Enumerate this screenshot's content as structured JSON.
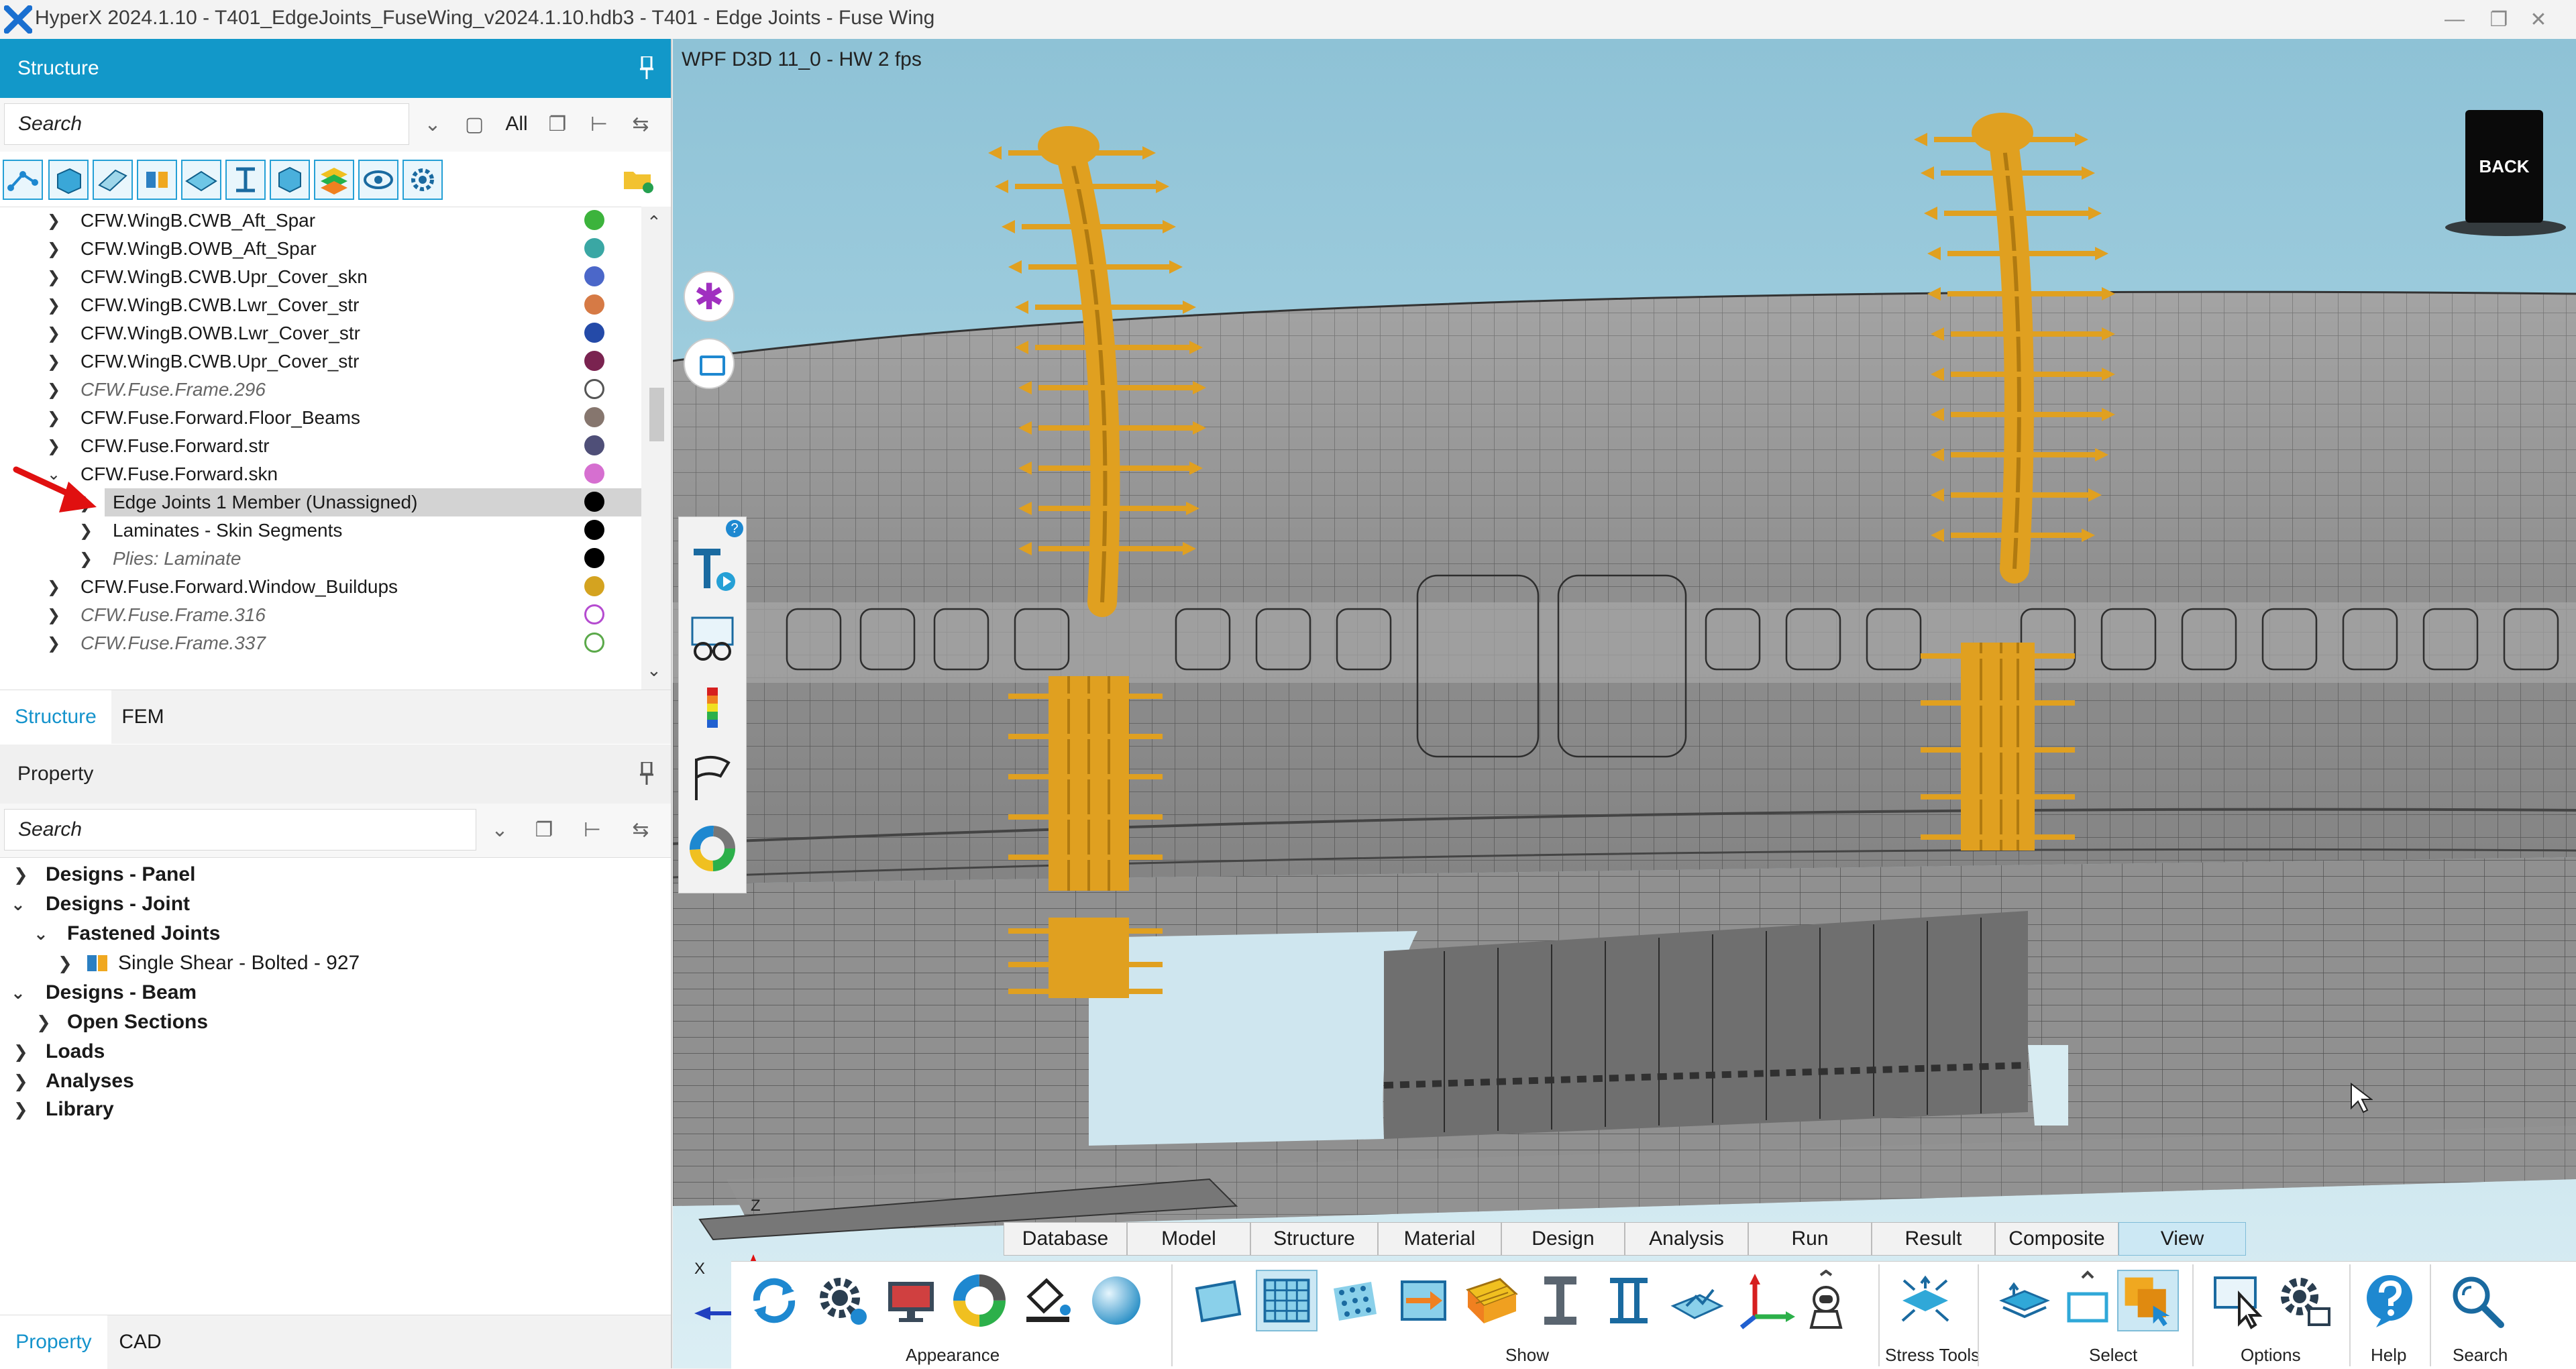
{
  "window": {
    "title": "HyperX 2024.1.10 - T401_EdgeJoints_FuseWing_v2024.1.10.hdb3 - T401 - Edge Joints - Fuse Wing"
  },
  "structure_pane": {
    "header": "Structure",
    "search_placeholder": "Search",
    "filter_label": "All",
    "tree": [
      {
        "label": "CFW.WingB.CWB_Aft_Spar",
        "italic": false,
        "color": "#3cb33c",
        "hollow": false
      },
      {
        "label": "CFW.WingB.OWB_Aft_Spar",
        "italic": false,
        "color": "#3aa7a4",
        "hollow": false
      },
      {
        "label": "CFW.WingB.CWB.Upr_Cover_skn",
        "italic": false,
        "color": "#4b67c9",
        "hollow": false
      },
      {
        "label": "CFW.WingB.CWB.Lwr_Cover_str",
        "italic": false,
        "color": "#d67a45",
        "hollow": false
      },
      {
        "label": "CFW.WingB.OWB.Lwr_Cover_str",
        "italic": false,
        "color": "#244aa8",
        "hollow": false
      },
      {
        "label": "CFW.WingB.CWB.Upr_Cover_str",
        "italic": false,
        "color": "#7a2350",
        "hollow": false
      },
      {
        "label": "CFW.Fuse.Frame.296",
        "italic": true,
        "color": "#555555",
        "hollow": true
      },
      {
        "label": "CFW.Fuse.Forward.Floor_Beams",
        "italic": false,
        "color": "#86766e",
        "hollow": false
      },
      {
        "label": "CFW.Fuse.Forward.str",
        "italic": false,
        "color": "#4f4f78",
        "hollow": false
      },
      {
        "label": "CFW.Fuse.Forward.skn",
        "italic": false,
        "color": "#d66fd0",
        "hollow": false
      },
      {
        "label": "Edge Joints 1 Member (Unassigned)",
        "italic": false,
        "color": "#000000",
        "hollow": false
      },
      {
        "label": "Laminates - Skin Segments",
        "italic": false,
        "color": "#000000",
        "hollow": false
      },
      {
        "label": "Plies: Laminate",
        "italic": true,
        "color": "#000000",
        "hollow": false
      },
      {
        "label": "CFW.Fuse.Forward.Window_Buildups",
        "italic": false,
        "color": "#d4a320",
        "hollow": false
      },
      {
        "label": "CFW.Fuse.Frame.316",
        "italic": true,
        "color": "#b54bd0",
        "hollow": true
      },
      {
        "label": "CFW.Fuse.Frame.337",
        "italic": true,
        "color": "#5ba94a",
        "hollow": true
      }
    ],
    "tabs": [
      "Structure",
      "FEM"
    ]
  },
  "property_pane": {
    "header": "Property",
    "search_placeholder": "Search",
    "items": [
      "Designs - Panel",
      "Designs - Joint",
      "Fastened Joints",
      "Single Shear - Bolted - 927",
      "Designs - Beam",
      "Open Sections",
      "Loads",
      "Analyses",
      "Library"
    ],
    "tabs": [
      "Property",
      "CAD"
    ]
  },
  "viewport": {
    "renderer_label": "WPF D3D 11_0 - HW  2  fps",
    "back_label": "BACK",
    "axis_z": "Z",
    "axis_x": "X",
    "help_badge": "?"
  },
  "ribbon": {
    "tabs": [
      "Database",
      "Model",
      "Structure",
      "Material",
      "Design",
      "Analysis",
      "Run",
      "Result",
      "Composite",
      "View"
    ],
    "active_tab": "View",
    "groups": [
      "Appearance",
      "Show",
      "Stress Tools",
      "Select",
      "Options",
      "Help",
      "Search"
    ]
  },
  "colors": {
    "accent": "#1298c9",
    "joint": "#e0a020",
    "mesh": "#8d8d8d"
  }
}
